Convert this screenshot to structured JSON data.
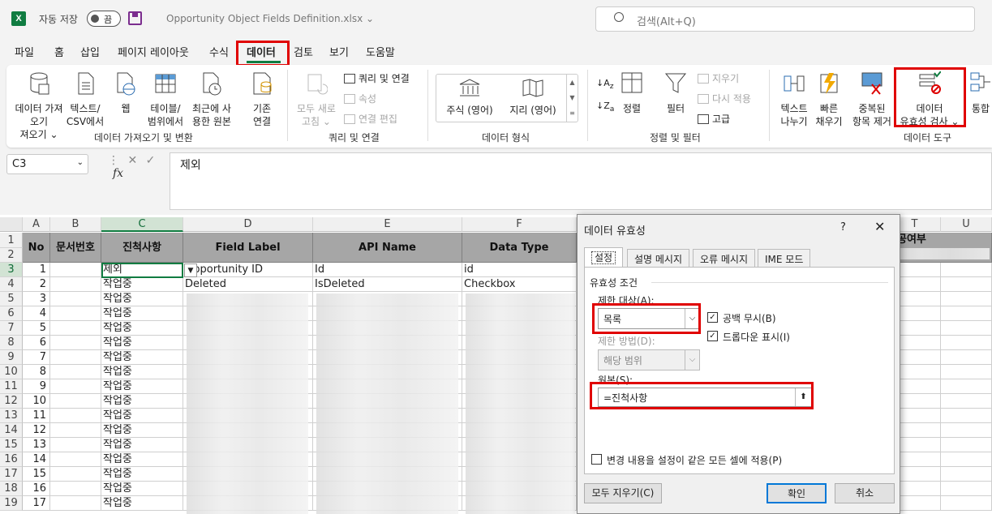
{
  "app": {
    "logo": "X",
    "autosave_label": "자동 저장",
    "toggle_label": "끔",
    "file_name": "Opportunity Object Fields Definition.xlsx",
    "search_placeholder": "검색(Alt+Q)"
  },
  "menu": [
    "파일",
    "홈",
    "삽입",
    "페이지 레이아웃",
    "수식",
    "데이터",
    "검토",
    "보기",
    "도움말"
  ],
  "ribbon": {
    "get_data": "데이터 가져오기",
    "get_data_2": "져오기",
    "text_csv": "텍스트/",
    "text_csv_2": "CSV에서",
    "web": "웹",
    "table_range": "테이블/",
    "table_range_2": "범위에서",
    "recent": "최근에 사",
    "recent_2": "용한 원본",
    "existing": "기존",
    "existing_2": "연결",
    "group_get": "데이터 가져오기 및 변환",
    "refresh_all": "모두 새로",
    "refresh_all_2": "고침",
    "queries": "쿼리 및 연결",
    "properties": "속성",
    "edit_links": "연결 편집",
    "group_queries": "쿼리 및 연결",
    "stocks": "주식 (영어)",
    "geography": "지리 (영어)",
    "group_types": "데이터 형식",
    "sort": "정렬",
    "filter": "필터",
    "clear": "지우기",
    "reapply": "다시 적용",
    "advanced": "고급",
    "group_sort": "정렬 및 필터",
    "text_to_col": "텍스트",
    "text_to_col_2": "나누기",
    "flash_fill": "빠른",
    "flash_fill_2": "채우기",
    "remove_dup": "중복된",
    "remove_dup_2": "항목 제거",
    "validation": "데이터",
    "validation_2": "유효성 검사",
    "consolidate": "통합",
    "group_tools": "데이터 도구"
  },
  "formula": {
    "name_box": "C3",
    "fx": "fx",
    "value": "제외"
  },
  "grid": {
    "columns": [
      "A",
      "B",
      "C",
      "D",
      "E",
      "F",
      "T",
      "U"
    ],
    "header_row": [
      "No",
      "문서번호",
      "진척사항",
      "Field Label",
      "API Name",
      "Data Type"
    ],
    "extra_header": "공여부",
    "rows": [
      {
        "r": "3",
        "no": "1",
        "status": "제외",
        "label": "Opportunity ID",
        "api": "Id",
        "type": "id"
      },
      {
        "r": "4",
        "no": "2",
        "status": "작업중",
        "label": "Deleted",
        "api": "IsDeleted",
        "type": "Checkbox"
      },
      {
        "r": "5",
        "no": "3",
        "status": "작업중"
      },
      {
        "r": "6",
        "no": "4",
        "status": "작업중"
      },
      {
        "r": "7",
        "no": "5",
        "status": "작업중"
      },
      {
        "r": "8",
        "no": "6",
        "status": "작업중"
      },
      {
        "r": "9",
        "no": "7",
        "status": "작업중"
      },
      {
        "r": "10",
        "no": "8",
        "status": "작업중"
      },
      {
        "r": "11",
        "no": "9",
        "status": "작업중"
      },
      {
        "r": "12",
        "no": "10",
        "status": "작업중"
      },
      {
        "r": "13",
        "no": "11",
        "status": "작업중"
      },
      {
        "r": "14",
        "no": "12",
        "status": "작업중"
      },
      {
        "r": "15",
        "no": "13",
        "status": "작업중"
      },
      {
        "r": "16",
        "no": "14",
        "status": "작업중"
      },
      {
        "r": "17",
        "no": "15",
        "status": "작업중"
      },
      {
        "r": "18",
        "no": "16",
        "status": "작업중"
      },
      {
        "r": "19",
        "no": "17",
        "status": "작업중"
      }
    ]
  },
  "dialog": {
    "title": "데이터 유효성",
    "help": "?",
    "close": "✕",
    "tabs": [
      "설정",
      "설명 메시지",
      "오류 메시지",
      "IME 모드"
    ],
    "criteria": "유효성 조건",
    "allow_label": "제한 대상(A):",
    "allow_value": "목록",
    "ignore_blank": "공백 무시(B)",
    "dropdown": "드롭다운 표시(I)",
    "data_label": "제한 방법(D):",
    "data_value": "해당 범위",
    "source_label": "원본(S):",
    "source_value": "=진척사항",
    "apply_all": "변경 내용을 설정이 같은 모든 셀에 적용(P)",
    "clear_all": "모두 지우기(C)",
    "ok": "확인",
    "cancel": "취소"
  },
  "colors": {
    "excel_green": "#107c41",
    "highlight_red": "#e00000",
    "header_gray": "#a6a6a6"
  }
}
